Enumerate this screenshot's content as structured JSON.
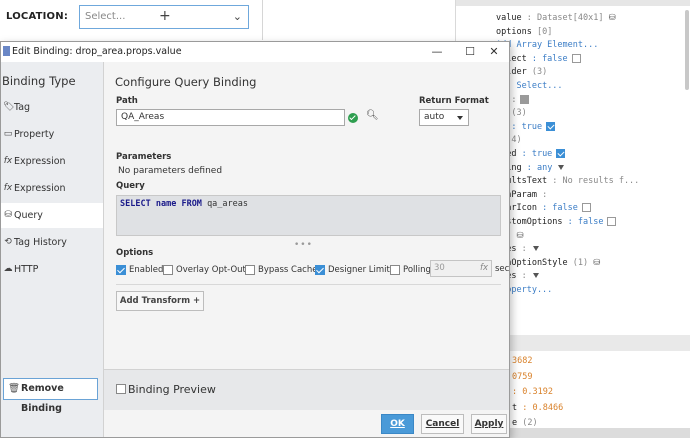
{
  "designer": {
    "location_label": "LOCATION:",
    "dropdown_placeholder": "Select...",
    "dropdown_plus": "+",
    "dropdown_chevron": "⌄"
  },
  "props": {
    "rows": [
      {
        "name": "value",
        "val": ": Dataset[40x1]",
        "val_class": "pval-gray",
        "extra": "db"
      },
      {
        "name": "options",
        "val": "[0]",
        "val_class": "pval-gray",
        "extra": ""
      },
      {
        "name": "",
        "val": "Add Array Element...",
        "val_class": "pval-blue",
        "extra": ""
      },
      {
        "name": "Select",
        "val": ": false",
        "val_class": "pval-blue",
        "extra": "chk"
      },
      {
        "name": "holder",
        "val": "(3)",
        "val_class": "pval-gray",
        "extra": ""
      },
      {
        "name": "t",
        "val": ": Select...",
        "val_class": "pval-blue",
        "extra": ""
      },
      {
        "name": "or",
        "val": ":",
        "val_class": "pval-gray",
        "extra": "swatch"
      },
      {
        "name": "on",
        "val": "(3)",
        "val_class": "pval-gray",
        "extra": ""
      },
      {
        "name": "ed",
        "val": ": true",
        "val_class": "pval-blue",
        "extra": "chkon"
      },
      {
        "name": "h",
        "val": "(4)",
        "val_class": "pval-gray",
        "extra": ""
      },
      {
        "name": "bled",
        "val": ": true",
        "val_class": "pval-blue",
        "extra": "chkon"
      },
      {
        "name": "ching",
        "val": ": any",
        "val_class": "pval-blue",
        "extra": "tri"
      },
      {
        "name": "esultsText",
        "val": ": No results f...",
        "val_class": "pval-gray",
        "extra": ""
      },
      {
        "name": "rchParam",
        "val": ":",
        "val_class": "pval-gray",
        "extra": ""
      },
      {
        "name": "learIcon",
        "val": ": false",
        "val_class": "pval-blue",
        "extra": "chk"
      },
      {
        "name": "CustomOptions",
        "val": ": false",
        "val_class": "pval-blue",
        "extra": "chk"
      },
      {
        "name": "",
        "val": "(1)",
        "val_class": "pval-gray",
        "extra": "db"
      },
      {
        "name": "sses",
        "val": ":",
        "val_class": "pval-gray",
        "extra": "tri"
      },
      {
        "name": "ownOptionStyle",
        "val": "(1)",
        "val_class": "pval-gray",
        "extra": "db"
      },
      {
        "name": "sses",
        "val": ":",
        "val_class": "pval-gray",
        "extra": "tri"
      },
      {
        "name": "",
        "val": "Property...",
        "val_class": "pval-blue",
        "extra": ""
      }
    ],
    "position_rows": [
      {
        "name": "",
        "val": "3682",
        "val_class": "pval-orange"
      },
      {
        "name": "",
        "val": "0759",
        "val_class": "pval-orange"
      },
      {
        "name": "",
        "val": ": 0.3192",
        "val_class": "pval-orange"
      },
      {
        "name": "t",
        "val": ": 0.8466",
        "val_class": "pval-orange"
      },
      {
        "name": "e",
        "val": "(2)",
        "val_class": "pval-gray"
      }
    ]
  },
  "dialog": {
    "title": "Edit Binding: drop_area.props.value",
    "minimize": "—",
    "maximize": "☐",
    "close": "✕",
    "sidebar": {
      "header": "Binding Type",
      "items": [
        {
          "label": "Tag",
          "icon": "🏷"
        },
        {
          "label": "Property",
          "icon": "▭"
        },
        {
          "label": "Expression",
          "icon": "fx"
        },
        {
          "label": "Expression Structure",
          "icon": "fx"
        },
        {
          "label": "Query",
          "icon": "⛁"
        },
        {
          "label": "Tag History",
          "icon": "⟲"
        },
        {
          "label": "HTTP",
          "icon": "☁"
        }
      ],
      "remove_label": "Remove Binding"
    },
    "main": {
      "title": "Configure Query Binding",
      "path_label": "Path",
      "path_value": "QA_Areas",
      "return_label": "Return Format",
      "return_value": "auto",
      "params_label": "Parameters",
      "params_empty": "No parameters defined",
      "query_label": "Query",
      "query_keyword_select": "SELECT",
      "query_field": "name",
      "query_keyword_from": "FROM",
      "query_table": "qa_areas",
      "resize_dots": "•••",
      "options_label": "Options",
      "options": {
        "enabled": "Enabled",
        "overlay": "Overlay Opt-Out",
        "bypass": "Bypass Cache",
        "designer": "Designer Limit",
        "polling": "Polling"
      },
      "polling_value": "30",
      "polling_fx": "fx",
      "polling_unit": "sec",
      "add_transform": "Add Transform +"
    },
    "preview_label": "Binding Preview",
    "buttons": {
      "ok": "OK",
      "cancel": "Cancel",
      "apply": "Apply"
    }
  }
}
